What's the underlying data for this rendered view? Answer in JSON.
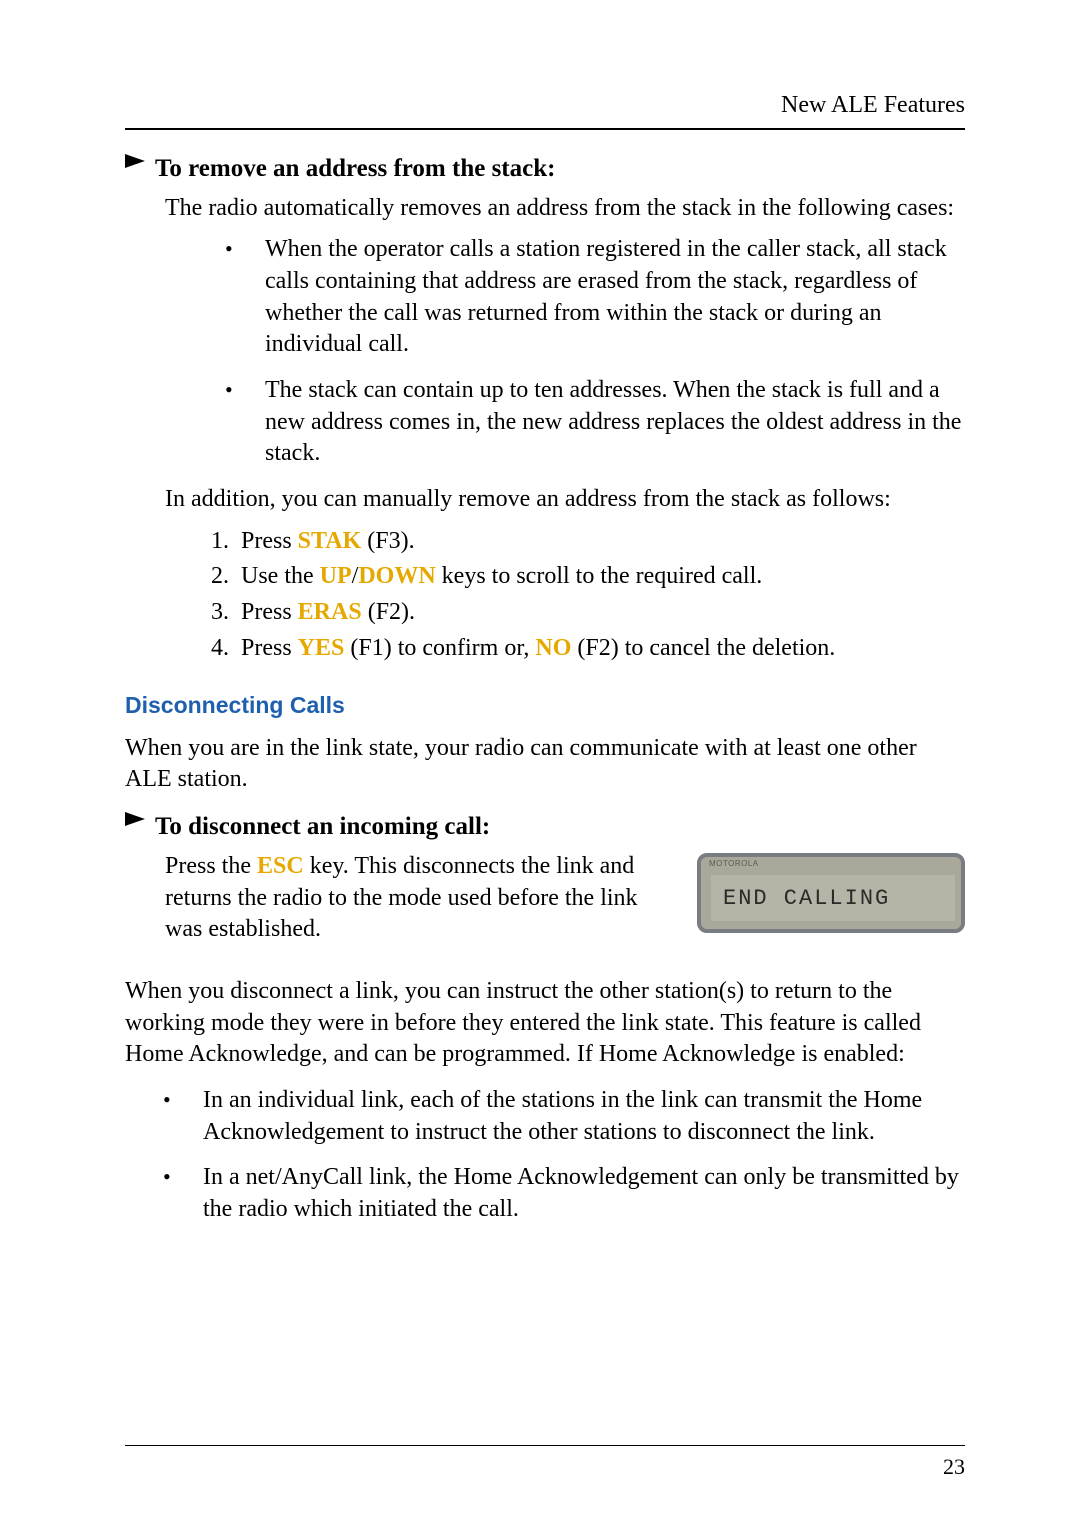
{
  "header": {
    "title": "New ALE Features"
  },
  "section1": {
    "heading": "To remove an address from the stack:",
    "intro": "The radio automatically removes an address from the stack in the following cases:",
    "bullets": [
      "When the operator calls a station registered in the caller stack, all stack calls containing that address are erased from the stack, regardless of whether the call was returned from within the stack or during an individual call.",
      "The stack can contain up to ten addresses. When the stack is full and a new address comes in, the new address replaces the oldest address in the stack."
    ],
    "followup": "In addition, you can manually remove an address from the stack as follows:",
    "steps": {
      "s1_pre": "Press ",
      "s1_key": "STAK",
      "s1_post": " (F3).",
      "s2_pre": "Use the ",
      "s2_key1": "UP",
      "s2_slash": "/",
      "s2_key2": "DOWN",
      "s2_post": " keys to scroll to the required call.",
      "s3_pre": "Press ",
      "s3_key": "ERAS",
      "s3_post": " (F2).",
      "s4_pre": "Press ",
      "s4_key1": "YES",
      "s4_mid": " (F1) to confirm or, ",
      "s4_key2": "NO",
      "s4_post": " (F2) to cancel the deletion."
    }
  },
  "section2": {
    "heading": "Disconnecting Calls",
    "para1": "When you are in the link state, your radio can communicate with at least one other ALE station.",
    "subheading": "To disconnect an incoming call:",
    "disc_pre": "Press the ",
    "disc_key": "ESC",
    "disc_post": " key. This disconnects the link and returns the radio to the mode used before the link was established.",
    "lcd_brand": "MOTOROLA",
    "lcd_text": "END CALLING",
    "para2": "When you disconnect a link, you can instruct the other station(s) to return to the working mode they were in before they entered the link state. This feature is called Home Acknowledge, and can be programmed. If Home Acknowledge is enabled:",
    "bullets": [
      "In an individual link, each of the stations in the link can transmit the Home Acknowledgement to instruct the other stations to disconnect the link.",
      "In a net/AnyCall link, the Home Acknowledgement can only be transmitted by the radio which initiated the call."
    ]
  },
  "footer": {
    "page": "23"
  }
}
